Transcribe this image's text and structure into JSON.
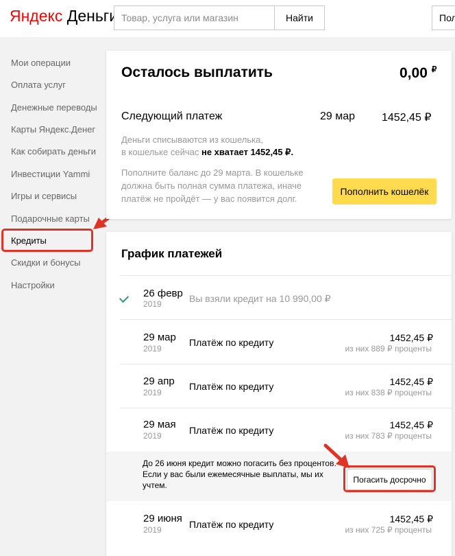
{
  "header": {
    "logo_brand": "Яндекс",
    "logo_product": "Деньги",
    "search_placeholder": "Товар, услуга или магазин",
    "search_button": "Найти",
    "right_button": "Пол"
  },
  "sidebar": {
    "items": [
      {
        "label": "Мои операции"
      },
      {
        "label": "Оплата услуг"
      },
      {
        "label": "Денежные переводы"
      },
      {
        "label": "Карты Яндекс.Денег"
      },
      {
        "label": "Как собирать деньги"
      },
      {
        "label": "Инвестиции Yammi"
      },
      {
        "label": "Игры и сервисы"
      },
      {
        "label": "Подарочные карты"
      },
      {
        "label": "Кредиты",
        "active": true
      },
      {
        "label": "Скидки и бонусы"
      },
      {
        "label": "Настройки"
      }
    ]
  },
  "summary": {
    "title": "Осталось выплатить",
    "remaining": "0,00",
    "currency": "₽",
    "next_label": "Следующий платеж",
    "next_date": "29 мар",
    "next_amount": "1452,45 ₽",
    "info1_line1": "Деньги списываются из кошелька,",
    "info1_line2_prefix": "в кошельке сейчас",
    "info1_line2_bold": "не хватает 1452,45 ₽.",
    "info2_line1": "Пополните баланс до 29 марта. В кошельке",
    "info2_line2": "должна быть полная сумма платежа, иначе",
    "info2_line3": "платёж не пройдёт — у вас появится долг.",
    "fill_button": "Пополнить кошелёк"
  },
  "schedule": {
    "title": "График платежей",
    "first_row": {
      "date": "26 февр",
      "year": "2019",
      "text": "Вы взяли кредит на",
      "amount": "10 990,00 ₽"
    },
    "rows": [
      {
        "date": "29 мар",
        "year": "2019",
        "title": "Платёж по кредиту",
        "amount": "1452,45 ₽",
        "sub": "из них 889 ₽ проценты"
      },
      {
        "date": "29 апр",
        "year": "2019",
        "title": "Платёж по кредиту",
        "amount": "1452,45 ₽",
        "sub": "из них 838 ₽ проценты"
      },
      {
        "date": "29 мая",
        "year": "2019",
        "title": "Платёж по кредиту",
        "amount": "1452,45 ₽",
        "sub": "из них 783 ₽ проценты"
      },
      {
        "date": "29 июня",
        "year": "2019",
        "title": "Платёж по кредиту",
        "amount": "1452,45 ₽",
        "sub": "из них 725 ₽ проценты"
      }
    ],
    "notice_text": "До 26 июня кредит можно погасить без процентов. Если у вас были ежемесячные выплаты, мы их учтем.",
    "early_button": "Погасить досрочно"
  },
  "colors": {
    "accent_red": "#e03328",
    "yellow_button": "#ffdb4d",
    "check_green": "#2a9d7a"
  }
}
